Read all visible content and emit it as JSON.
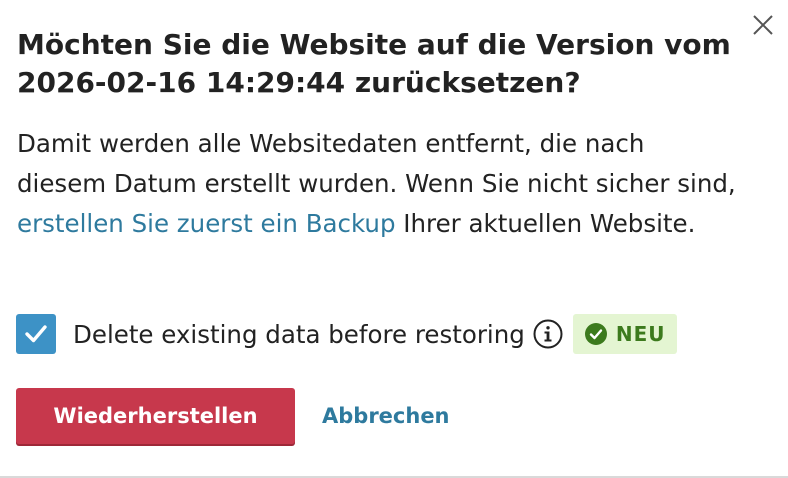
{
  "dialog": {
    "title": "Möchten Sie die Website auf die Version vom 2026-02-16 14:29:44 zurücksetzen?",
    "body_before_link": "Damit werden alle Websitedaten entfernt, die nach diesem Datum erstellt wurden. Wenn Sie nicht sicher sind, ",
    "body_link": "erstellen Sie zuerst ein Backup",
    "body_after_link": " Ihrer aktuellen Website.",
    "option": {
      "label": "Delete existing data before restoring",
      "checked": true,
      "badge": "NEU"
    },
    "primary_button": "Wiederherstellen",
    "cancel_button": "Abbrechen"
  },
  "icons": {
    "close": "close-icon",
    "check": "check-icon",
    "info": "info-icon",
    "badge": "check-circle-icon"
  },
  "colors": {
    "primary_button": "#c7384c",
    "link": "#2e7a9e",
    "checkbox": "#3d92c6",
    "badge_bg": "#e4f5d2",
    "badge_text": "#3c7a1d"
  }
}
